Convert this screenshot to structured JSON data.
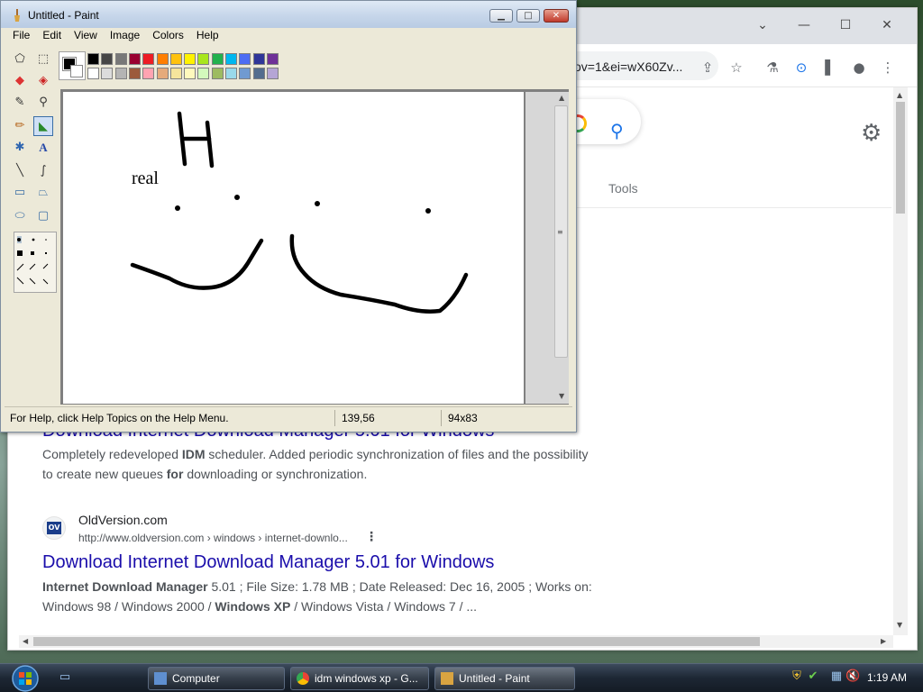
{
  "browser": {
    "address_text": "ov=1&ei=wX60Zv...",
    "tools_label": "Tools",
    "results": {
      "top_title_partial": "Download Internet Download Manager 5.01 for Windows",
      "top_snippet_line1_a": "Completely redeveloped ",
      "top_snippet_line1_b": "IDM",
      "top_snippet_line1_c": " scheduler. Added periodic synchronization of files and the possibility",
      "top_snippet_line2_a": "to create new queues ",
      "top_snippet_line2_b": "for",
      "top_snippet_line2_c": " downloading or synchronization.",
      "second_site_name": "OldVersion.com",
      "second_site_url": "http://www.oldversion.com › windows › internet-downlo...",
      "second_favicon_text": "OV",
      "second_title": "Download Internet Download Manager 5.01 for Windows",
      "second_snippet_line1_a": "Internet Download Manager",
      "second_snippet_line1_b": " 5.01 ; File Size: 1.78 MB ; Date Released: Dec 16, 2005 ; Works on:",
      "second_snippet_line2_a": "Windows 98 / Windows 2000 / ",
      "second_snippet_line2_b": "Windows XP",
      "second_snippet_line2_c": " / Windows Vista / Windows 7 / ..."
    }
  },
  "paint": {
    "title": "Untitled - Paint",
    "menu": [
      "File",
      "Edit",
      "View",
      "Image",
      "Colors",
      "Help"
    ],
    "canvas_text": "real",
    "canvas_letter": "H",
    "status_help": "For Help, click Help Topics on the Help Menu.",
    "status_pos": "139,56",
    "status_size": "94x83",
    "palette_top": [
      "#000000",
      "#464646",
      "#787878",
      "#990030",
      "#ed1c24",
      "#ff7e00",
      "#ffc20e",
      "#fff200",
      "#a8e61d",
      "#22b14c",
      "#00b7ef",
      "#4d6df3",
      "#2f3699",
      "#6f3198"
    ],
    "palette_bottom": [
      "#ffffff",
      "#dcdcdc",
      "#b4b4b4",
      "#9c5a3c",
      "#ffa3b1",
      "#e5aa7a",
      "#f5e49c",
      "#fff9bd",
      "#d3f9bc",
      "#9dbb61",
      "#99d9ea",
      "#709ad1",
      "#546d8e",
      "#b5a5d5"
    ],
    "primary_color": "#000000",
    "secondary_color": "#ffffff"
  },
  "taskbar": {
    "items": [
      "Computer",
      "idm windows xp - G...",
      "Untitled - Paint"
    ],
    "clock": "1:19 AM"
  }
}
